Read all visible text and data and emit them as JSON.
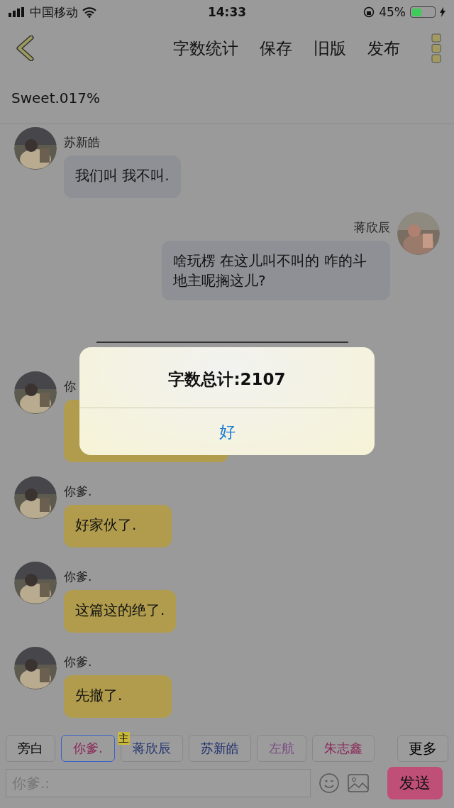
{
  "status_bar": {
    "carrier": "中国移动",
    "time": "14:33",
    "battery": "45%"
  },
  "nav": {
    "actions": [
      "字数统计",
      "保存",
      "旧版",
      "发布"
    ]
  },
  "title": "Sweet.017%",
  "messages": [
    {
      "kind": "left",
      "sender": "苏新皓",
      "text": "我们叫 我不叫.",
      "color": "#8e9096"
    },
    {
      "kind": "right",
      "sender": "蒋欣辰",
      "text": "啥玩楞 在这儿叫不叫的 咋的斗地主呢搁这儿?",
      "color": "#8e9096"
    },
    {
      "kind": "divider"
    },
    {
      "kind": "left",
      "sender": "你",
      "color": "#b09c4c"
    },
    {
      "kind": "left",
      "sender": "你爹.",
      "text": "好家伙了.",
      "color": "#b09c4c"
    },
    {
      "kind": "left",
      "sender": "你爹.",
      "text": "这篇这的绝了.",
      "color": "#b09c4c"
    },
    {
      "kind": "left",
      "sender": "你爹.",
      "text": "先撤了.",
      "color": "#b09c4c"
    }
  ],
  "alert": {
    "message": "字数总计:2107",
    "button": "好"
  },
  "roles": [
    {
      "kind": "role",
      "label": "旁白",
      "color": "#000000",
      "selected": false
    },
    {
      "kind": "role",
      "label": "你爹.",
      "color": "#8a2658",
      "selected": true
    },
    {
      "kind": "role",
      "label": "蒋欣辰",
      "color": "#1f2f6e",
      "selected": false,
      "badge": "主"
    },
    {
      "kind": "role",
      "label": "苏新皓",
      "color": "#1f2f6e",
      "selected": false
    },
    {
      "kind": "role",
      "label": "左航",
      "color": "#7c4f86",
      "selected": false
    },
    {
      "kind": "role",
      "label": "朱志鑫",
      "color": "#8a2658",
      "selected": false
    },
    {
      "kind": "more",
      "label": "更多",
      "color": "#000000",
      "selected": false
    }
  ],
  "input": {
    "placeholder": "你爹.:",
    "send": "发送"
  }
}
